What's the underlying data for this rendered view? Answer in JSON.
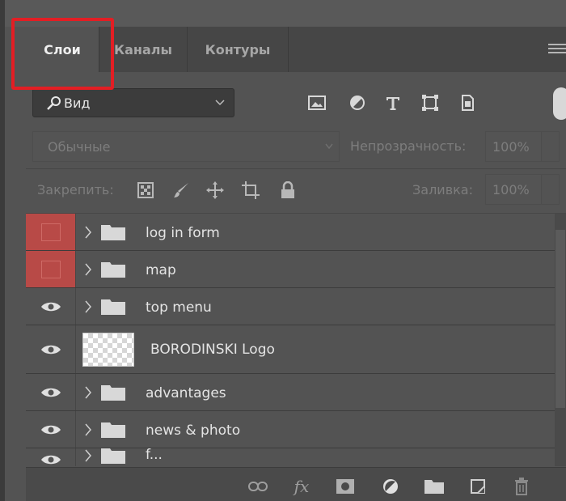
{
  "tabs": [
    {
      "label": "Слои",
      "active": true
    },
    {
      "label": "Каналы",
      "active": false
    },
    {
      "label": "Контуры",
      "active": false
    }
  ],
  "filter": {
    "label": "Вид",
    "icons": [
      "image-filter-icon",
      "adjustment-filter-icon",
      "type-filter-icon",
      "shape-filter-icon",
      "smart-object-filter-icon"
    ]
  },
  "blend": {
    "mode": "Обычные",
    "opacity_label": "Непрозрачность:",
    "opacity_value": "100%"
  },
  "lock": {
    "label": "Закрепить:",
    "fill_label": "Заливка:",
    "fill_value": "100%"
  },
  "layers": [
    {
      "name": "log in form",
      "type": "group",
      "visible": false
    },
    {
      "name": "map",
      "type": "group",
      "visible": false
    },
    {
      "name": "top menu",
      "type": "group",
      "visible": true
    },
    {
      "name": "BORODINSKI Logo",
      "type": "layer",
      "visible": true
    },
    {
      "name": "advantages",
      "type": "group",
      "visible": true
    },
    {
      "name": "news & photo",
      "type": "group",
      "visible": true
    },
    {
      "name": "f...",
      "type": "group",
      "visible": true
    }
  ],
  "colors": {
    "highlight": "#e31e24",
    "hidden_layer": "#b84a47"
  }
}
